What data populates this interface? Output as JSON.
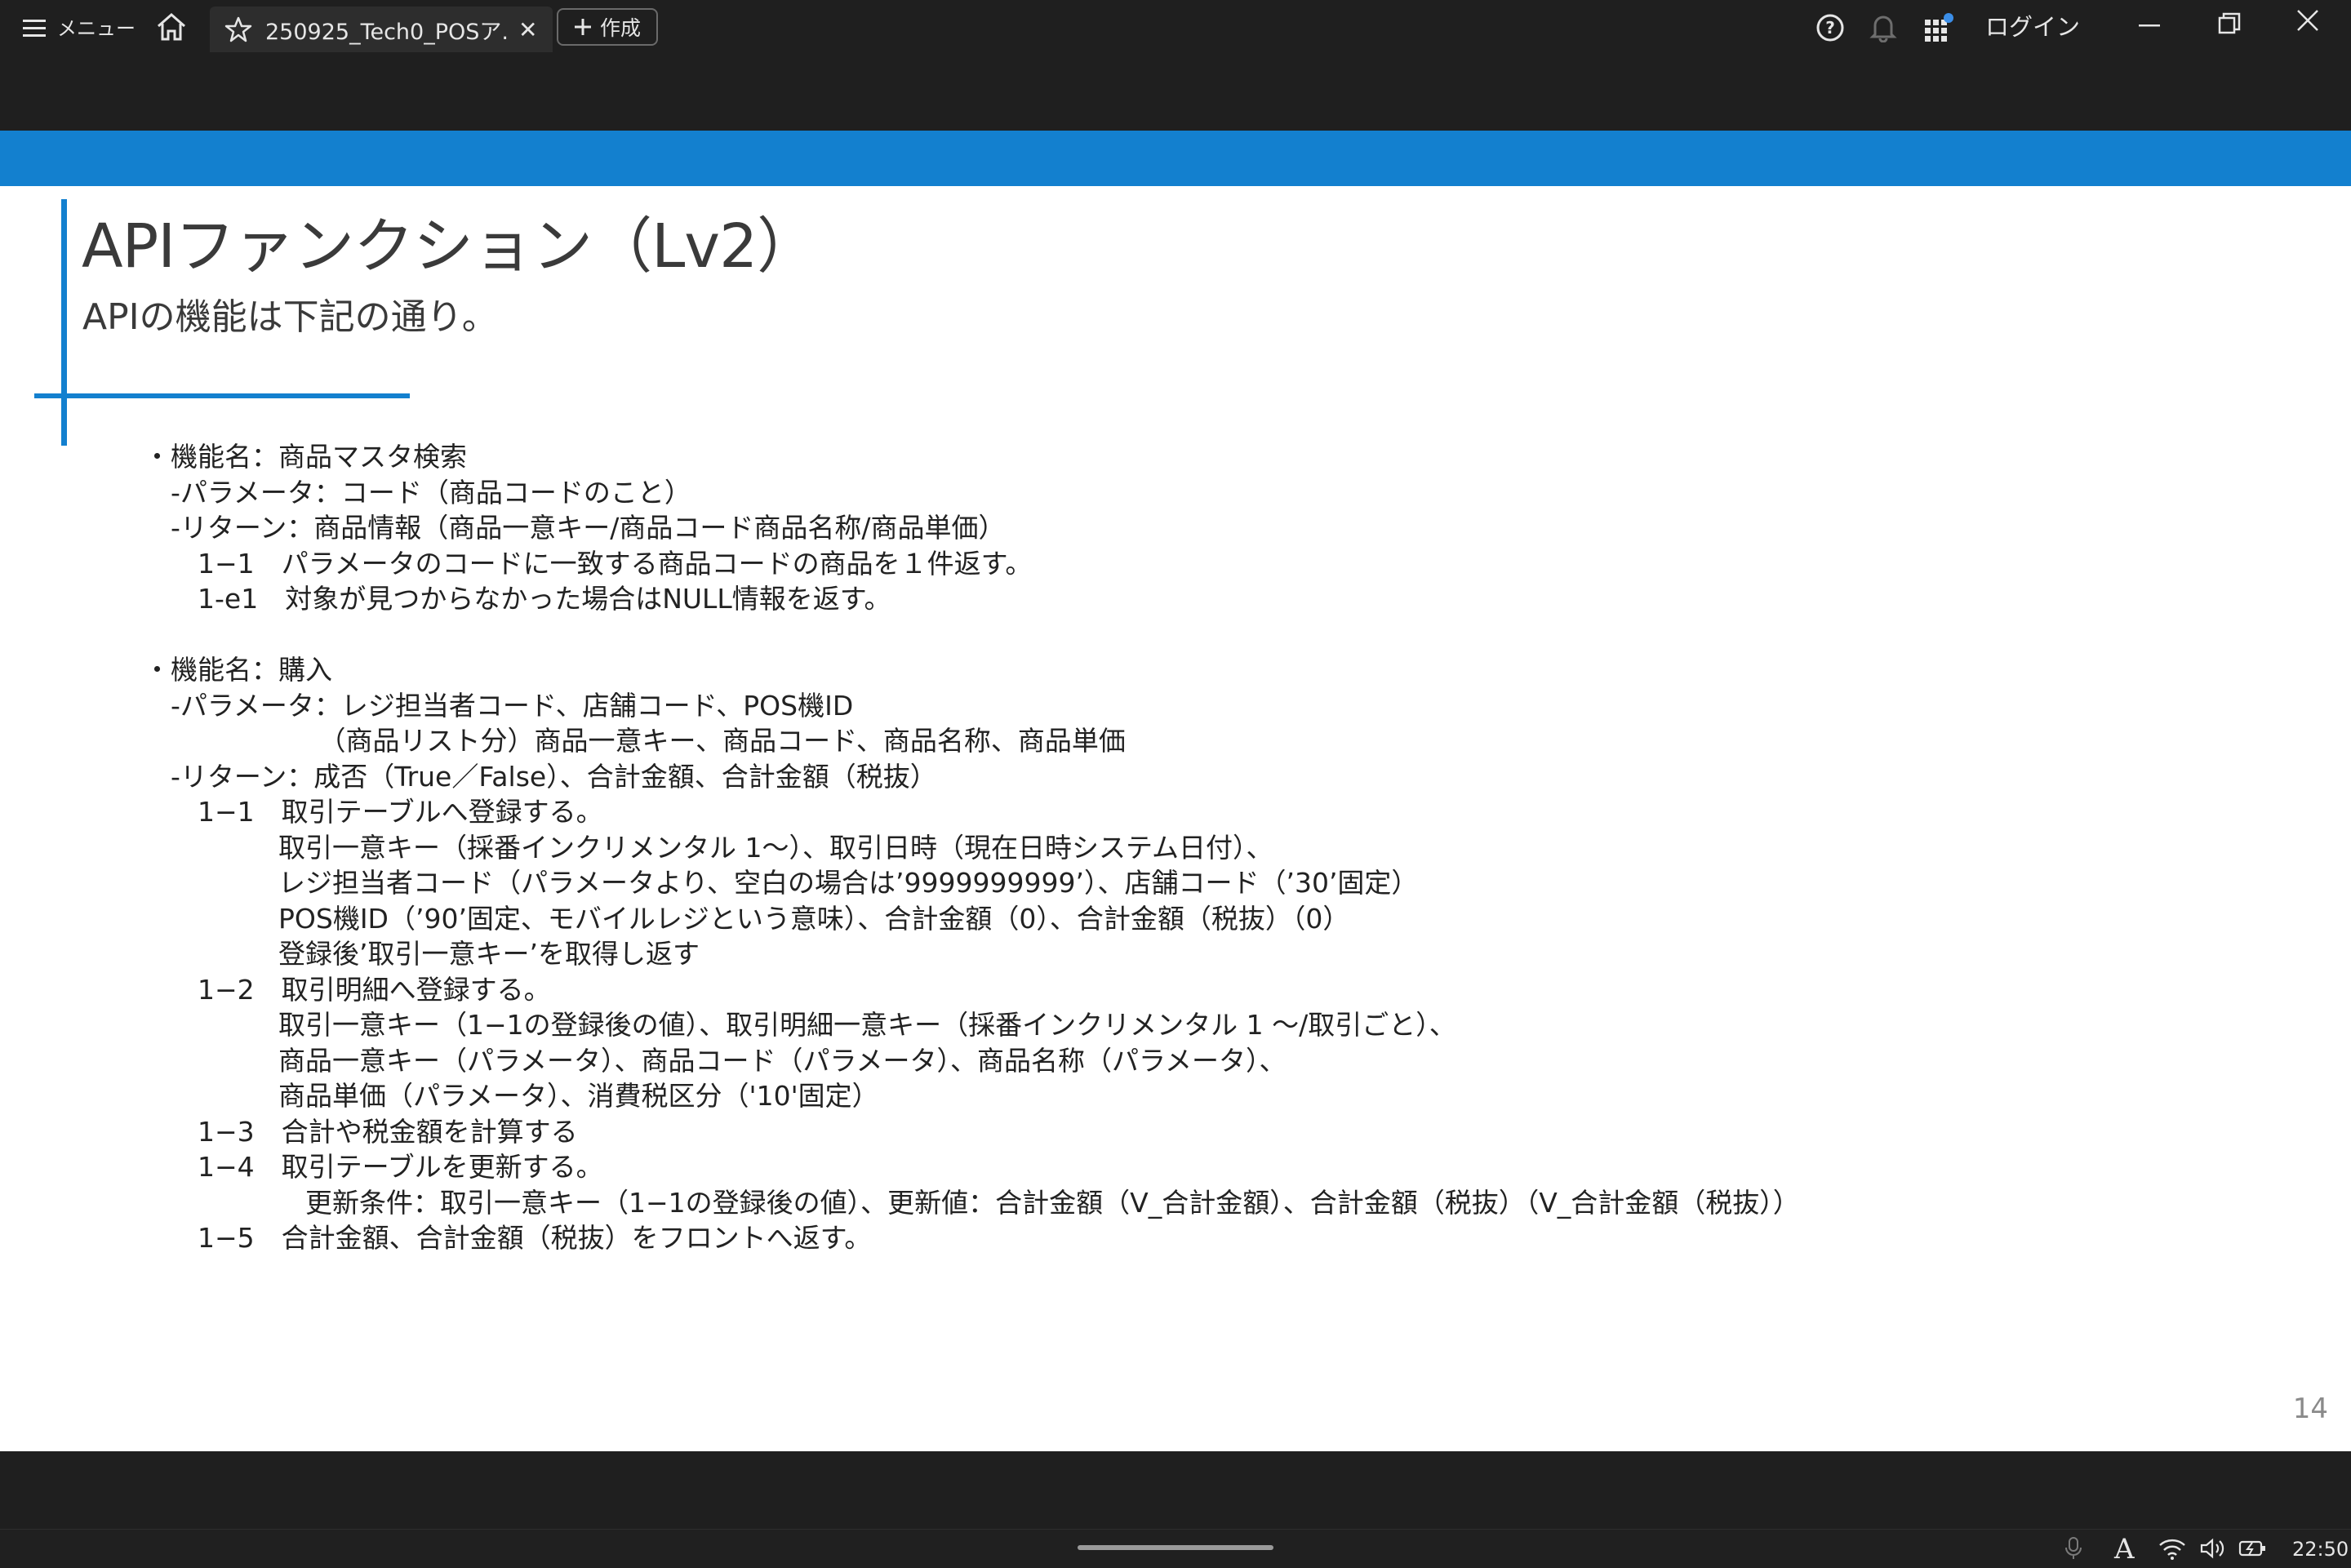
{
  "topbar": {
    "menu_label": "メニュー",
    "tab_title": "250925_Tech0_POSア...",
    "new_button_label": "作成",
    "login_label": "ログイン"
  },
  "slide": {
    "title": "APIファンクション（Lv2）",
    "subtitle": "APIの機能は下記の通り。",
    "lines": [
      "・機能名：商品マスタ検索",
      "　-パラメータ：コード（商品コードのこと）",
      "　-リターン：商品情報（商品一意キー/商品コード商品名称/商品単価）",
      "　　1−1　パラメータのコードに一致する商品コードの商品を１件返す。",
      "　　1-e1　対象が見つからなかった場合はNULL情報を返す。",
      "",
      "・機能名：購入",
      "　-パラメータ：レジ担当者コード、店舗コード、POS機ID",
      "　　　　　　　（商品リスト分）商品一意キー、商品コード、商品名称、商品単価",
      "　-リターン：成否（True／False）、合計金額、合計金額（税抜）",
      "　　1−1　取引テーブルへ登録する。",
      "　　　　　取引一意キー（採番インクリメンタル 1〜）、取引日時（現在日時システム日付）、",
      "　　　　　レジ担当者コード（パラメータより、空白の場合は’9999999999’）、店舗コード（’30’固定）",
      "　　　　　POS機ID（’90’固定、モバイルレジという意味）、合計金額（0）、合計金額（税抜）（0）",
      "　　　　　登録後’取引一意キー’を取得し返す",
      "　　1−2　取引明細へ登録する。",
      "　　　　　取引一意キー（1−1の登録後の値）、取引明細一意キー（採番インクリメンタル 1 〜/取引ごと）、",
      "　　　　　商品一意キー（パラメータ）、商品コード（パラメータ）、商品名称（パラメータ）、",
      "　　　　　商品単価（パラメータ）、消費税区分（'10'固定）",
      "　　1−3　合計や税金額を計算する",
      "　　1−4　取引テーブルを更新する。",
      "　　　　　　更新条件：取引一意キー（1−1の登録後の値）、更新値：合計金額（V_合計金額）、合計金額（税抜）（V_合計金額（税抜））",
      "　　1−5　合計金額、合計金額（税抜）をフロントへ返す。"
    ],
    "page_number": "14"
  },
  "taskbar": {
    "ime_indicator": "A",
    "clock": "22:50"
  },
  "icons": {
    "menu": "hamburger-icon",
    "home": "home-icon",
    "star": "star-icon",
    "close": "close-icon",
    "plus": "plus-icon",
    "help": "help-icon",
    "bell": "bell-icon",
    "apps": "apps-grid-icon",
    "minimize": "minimize-icon",
    "restore": "restore-icon",
    "mic": "microphone-icon",
    "wifi": "wifi-icon",
    "volume": "volume-icon",
    "battery": "battery-icon"
  },
  "colors": {
    "accent_blue": "#1380cf",
    "chrome_dark": "#1f1f1f",
    "notification_dot": "#3b8ee8"
  }
}
